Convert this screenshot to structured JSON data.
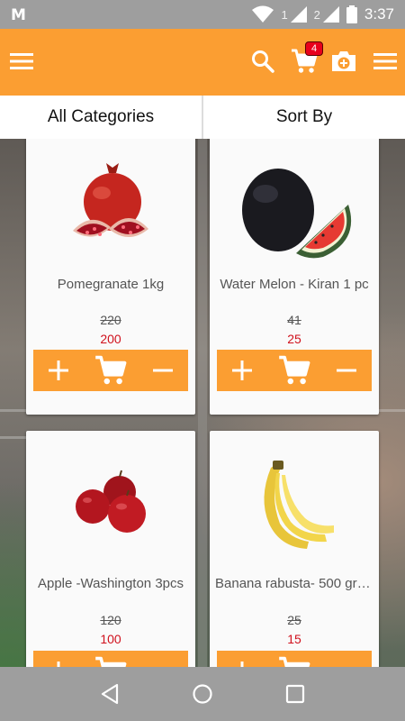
{
  "status_bar": {
    "carrier_logo": "M",
    "sim1": "1",
    "sim2": "2",
    "time": "3:37",
    "icons": [
      "wifi-icon",
      "signal-icon",
      "signal-icon",
      "battery-icon"
    ]
  },
  "app_bar": {
    "background": "#fb9e32",
    "cart_count": "4",
    "icons": [
      "menu-icon",
      "search-icon",
      "cart-icon",
      "camera-icon",
      "menu-icon"
    ]
  },
  "filters": {
    "categories_label": "All Categories",
    "sort_label": "Sort By"
  },
  "products": [
    {
      "name": "Pomegranate 1kg",
      "old_price": "220",
      "price": "200",
      "image": "pomegranate-image"
    },
    {
      "name": "Water Melon - Kiran 1 pc",
      "old_price": "41",
      "price": "25",
      "image": "watermelon-image"
    },
    {
      "name": "Apple -Washington 3pcs",
      "old_price": "120",
      "price": "100",
      "image": "apple-image"
    },
    {
      "name": "Banana rabusta- 500 gra...",
      "old_price": "25",
      "price": "15",
      "image": "banana-image"
    }
  ],
  "card_actions": [
    "plus-icon",
    "add-to-cart-icon",
    "minus-icon"
  ],
  "price_color": "#d0111d",
  "nav_bar": {
    "icons": [
      "back-icon",
      "home-icon",
      "recents-icon"
    ]
  }
}
